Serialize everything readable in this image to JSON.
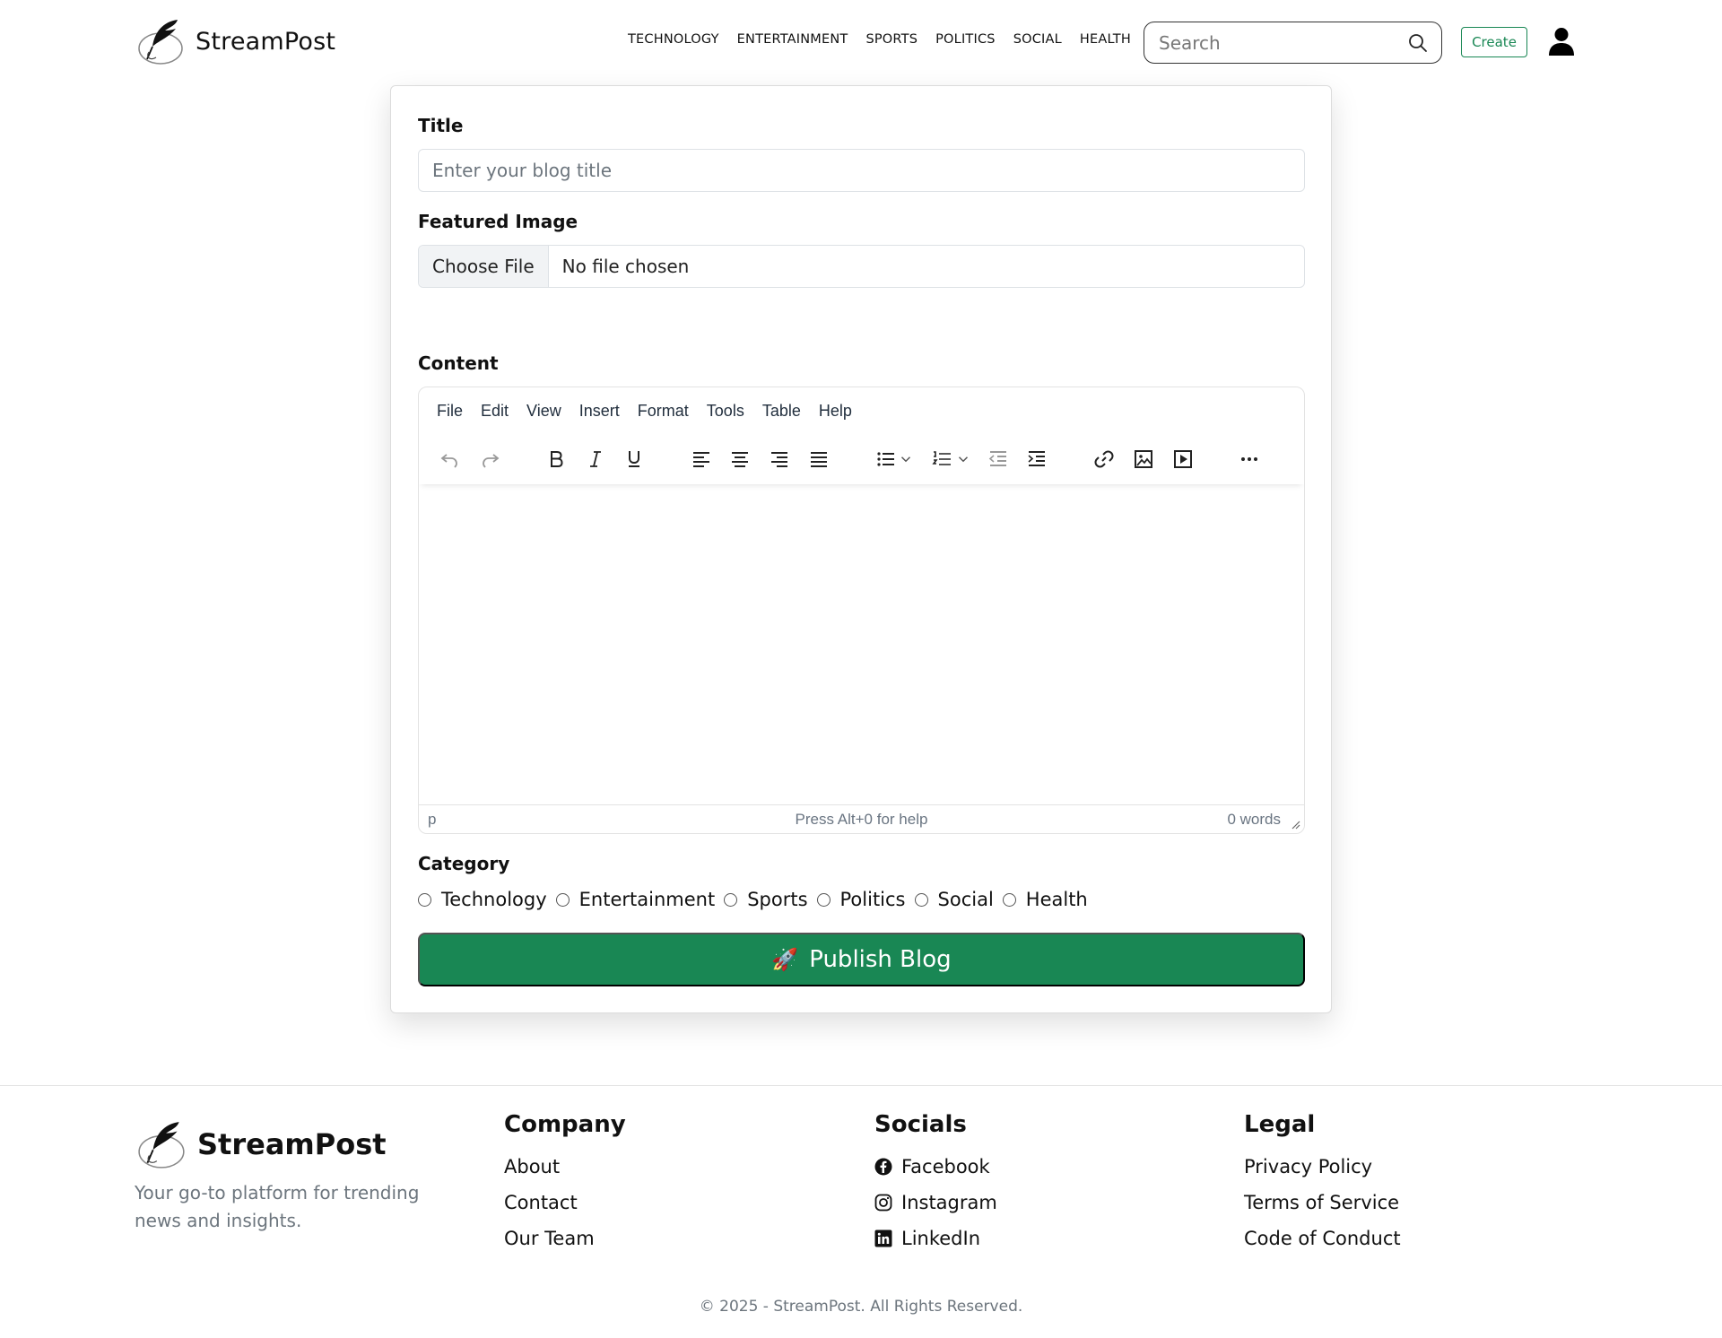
{
  "header": {
    "brand": "StreamPost",
    "nav": [
      "TECHNOLOGY",
      "ENTERTAINMENT",
      "SPORTS",
      "POLITICS",
      "SOCIAL",
      "HEALTH"
    ],
    "search_placeholder": "Search",
    "create_label": "Create"
  },
  "form": {
    "title_label": "Title",
    "title_placeholder": "Enter your blog title",
    "image_label": "Featured Image",
    "choose_file": "Choose File",
    "no_file": "No file chosen",
    "content_label": "Content",
    "category_label": "Category",
    "categories": [
      "Technology",
      "Entertainment",
      "Sports",
      "Politics",
      "Social",
      "Health"
    ],
    "publish_label": "Publish Blog",
    "publish_icon": "🚀",
    "accent_color": "#198754"
  },
  "editor": {
    "menu": [
      "File",
      "Edit",
      "View",
      "Insert",
      "Format",
      "Tools",
      "Table",
      "Help"
    ],
    "status_path": "p",
    "status_help": "Press Alt+0 for help",
    "status_words": "0 words"
  },
  "footer": {
    "brand": "StreamPost",
    "tagline": "Your go-to platform for trending news and insights.",
    "company": {
      "title": "Company",
      "links": [
        "About",
        "Contact",
        "Our Team"
      ]
    },
    "socials": {
      "title": "Socials",
      "links": [
        "Facebook",
        "Instagram",
        "LinkedIn"
      ]
    },
    "legal": {
      "title": "Legal",
      "links": [
        "Privacy Policy",
        "Terms of Service",
        "Code of Conduct"
      ]
    },
    "copyright": "© 2025 - StreamPost. All Rights Reserved."
  }
}
